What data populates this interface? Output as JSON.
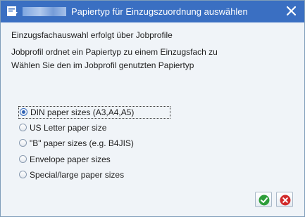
{
  "window": {
    "title": "Papiertyp für Einzugszuordnung auswählen",
    "icons": {
      "app": "dialog-window-icon",
      "close": "close-icon"
    }
  },
  "info_lines": [
    "Einzugsfachauswahl erfolgt über Jobprofile",
    "Jobprofil ordnet ein Papiertyp zu einem Einzugsfach zu",
    "Wählen Sie den im Jobprofil genutzten Papiertyp"
  ],
  "options": [
    {
      "label": "DIN paper sizes (A3,A4,A5)",
      "selected": true
    },
    {
      "label": "US Letter paper size",
      "selected": false
    },
    {
      "label": "\"B\" paper sizes (e.g. B4JIS)",
      "selected": false
    },
    {
      "label": "Envelope paper sizes",
      "selected": false
    },
    {
      "label": "Special/large paper sizes",
      "selected": false
    }
  ],
  "buttons": {
    "confirm_icon": "checkmark-icon",
    "cancel_icon": "cancel-icon"
  },
  "colors": {
    "titlebar": "#3a6fc2",
    "confirm": "#2e9e3a",
    "cancel": "#d12a2a"
  }
}
